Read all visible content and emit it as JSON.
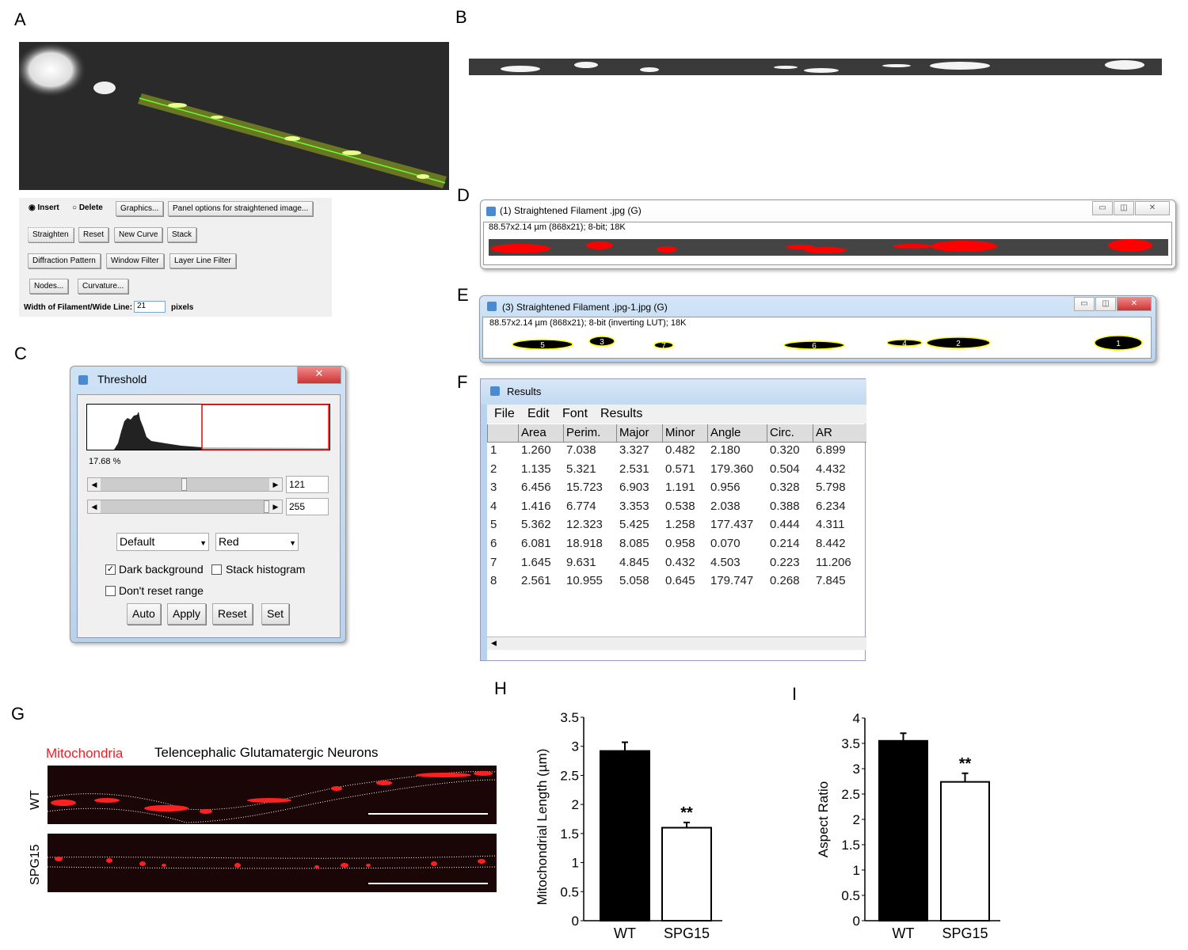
{
  "panels": {
    "a": "A",
    "b": "B",
    "c": "C",
    "d": "D",
    "e": "E",
    "f": "F",
    "g": "G",
    "h": "H",
    "i": "I"
  },
  "straighten_tool": {
    "radio_insert": "Insert",
    "radio_delete": "Delete",
    "selected": "Insert",
    "graphics": "Graphics...",
    "panel_options": "Panel options for straightened image...",
    "straighten": "Straighten",
    "reset": "Reset",
    "new_curve": "New Curve",
    "stack": "Stack",
    "diffraction": "Diffraction Pattern",
    "window_filter": "Window Filter",
    "layer_line": "Layer Line Filter",
    "nodes": "Nodes...",
    "curvature": "Curvature...",
    "width_label": "Width of Filament/Wide Line:",
    "width_value": "21",
    "width_unit": "pixels"
  },
  "threshold": {
    "title": "Threshold",
    "percent": "17.68 %",
    "min_value": "121",
    "max_value": "255",
    "min_fraction": 0.47,
    "max_fraction": 1.0,
    "method": "Default",
    "mode": "Red",
    "dark_background": "Dark background",
    "dark_background_checked": true,
    "stack_histogram": "Stack histogram",
    "stack_histogram_checked": false,
    "dont_reset": "Don't reset range",
    "dont_reset_checked": false,
    "buttons": [
      "Auto",
      "Apply",
      "Reset",
      "Set"
    ]
  },
  "window_d": {
    "title": "(1) Straightened Filament .jpg (G)",
    "info": "88.57x2.14 µm (868x21); 8-bit; 18K"
  },
  "window_e": {
    "title": "(3) Straightened Filament .jpg-1.jpg (G)",
    "info": "88.57x2.14 µm (868x21); 8-bit (inverting LUT); 18K",
    "particle_labels": [
      "5",
      "3",
      "7",
      "6",
      "4",
      "2",
      "1"
    ]
  },
  "results": {
    "title": "Results",
    "menu": [
      "File",
      "Edit",
      "Font",
      "Results"
    ],
    "columns": [
      "",
      "Area",
      "Perim.",
      "Major",
      "Minor",
      "Angle",
      "Circ.",
      "AR"
    ],
    "rows": [
      [
        "1",
        "1.260",
        "7.038",
        "3.327",
        "0.482",
        "2.180",
        "0.320",
        "6.899"
      ],
      [
        "2",
        "1.135",
        "5.321",
        "2.531",
        "0.571",
        "179.360",
        "0.504",
        "4.432"
      ],
      [
        "3",
        "6.456",
        "15.723",
        "6.903",
        "1.191",
        "0.956",
        "0.328",
        "5.798"
      ],
      [
        "4",
        "1.416",
        "6.774",
        "3.353",
        "0.538",
        "2.038",
        "0.388",
        "6.234"
      ],
      [
        "5",
        "5.362",
        "12.323",
        "5.425",
        "1.258",
        "177.437",
        "0.444",
        "4.311"
      ],
      [
        "6",
        "6.081",
        "18.918",
        "8.085",
        "0.958",
        "0.070",
        "0.214",
        "8.442"
      ],
      [
        "7",
        "1.645",
        "9.631",
        "4.845",
        "0.432",
        "4.503",
        "0.223",
        "11.206"
      ],
      [
        "8",
        "2.561",
        "10.955",
        "5.058",
        "0.645",
        "179.747",
        "0.268",
        "7.845"
      ]
    ]
  },
  "panel_g": {
    "mito_label": "Mitochondria",
    "title": "Telencephalic Glutamatergic Neurons",
    "row_labels": [
      "WT",
      "SPG15"
    ],
    "mito_color": "#e8202a"
  },
  "chart_data": [
    {
      "type": "bar",
      "title": "",
      "xlabel": "",
      "ylabel": "Mitochondrial Length (µm)",
      "categories": [
        "WT",
        "SPG15"
      ],
      "values": [
        2.92,
        1.6
      ],
      "errors": [
        0.15,
        0.09
      ],
      "fills": [
        "#000000",
        "#ffffff"
      ],
      "significance": [
        "",
        "**"
      ],
      "ylim": [
        0,
        3.5
      ],
      "yticks": [
        "0",
        "0.5",
        "1",
        "1.5",
        "2",
        "2.5",
        "3",
        "3.5"
      ],
      "grid": false
    },
    {
      "type": "bar",
      "title": "",
      "xlabel": "",
      "ylabel": "Aspect Ratio",
      "categories": [
        "WT",
        "SPG15"
      ],
      "values": [
        3.55,
        2.74
      ],
      "errors": [
        0.15,
        0.17
      ],
      "fills": [
        "#000000",
        "#ffffff"
      ],
      "significance": [
        "",
        "**"
      ],
      "ylim": [
        0,
        4
      ],
      "yticks": [
        "0",
        "0.5",
        "1",
        "1.5",
        "2",
        "2.5",
        "3",
        "3.5",
        "4"
      ],
      "grid": false
    }
  ]
}
